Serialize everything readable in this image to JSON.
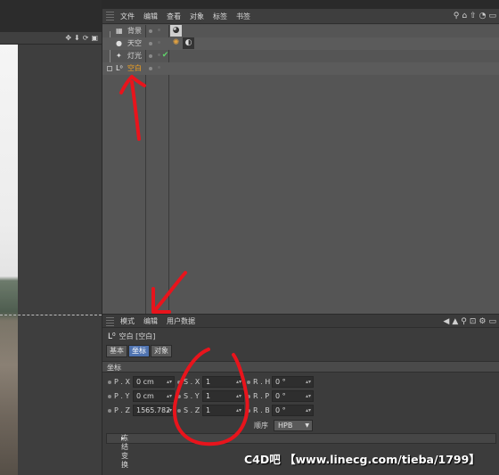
{
  "object_manager": {
    "menu": [
      "文件",
      "编辑",
      "查看",
      "对象",
      "标签",
      "书签"
    ],
    "toolbar_icons": [
      "search-icon",
      "home-icon",
      "up-icon",
      "pin-icon",
      "expand-icon"
    ],
    "objects": [
      {
        "name": "背景",
        "icon": "background-icon",
        "selected": false,
        "tag": "material-tag"
      },
      {
        "name": "天空",
        "icon": "sky-icon",
        "selected": false,
        "tag": "material-tag"
      },
      {
        "name": "灯光",
        "icon": "light-icon",
        "selected": false,
        "tag": "check-tag"
      },
      {
        "name": "空白",
        "icon": "null-icon",
        "selected": true,
        "tag": ""
      }
    ]
  },
  "viewport": {
    "toolbar_icons": [
      "move-icon",
      "down-arrow-icon",
      "rotate-icon",
      "maximize-icon"
    ]
  },
  "attribute_manager": {
    "menu": [
      "模式",
      "编辑",
      "用户数据"
    ],
    "toolbar_icons": [
      "back-arrow-icon",
      "up-arrow-icon",
      "search-icon",
      "lock-icon",
      "settings-icon",
      "expand-icon"
    ],
    "title": "空白 [空白]",
    "tabs": [
      {
        "label": "基本",
        "active": false
      },
      {
        "label": "坐标",
        "active": true
      },
      {
        "label": "对象",
        "active": false
      }
    ],
    "section": "坐标",
    "position": {
      "x": {
        "label": "P . X",
        "value": "0 cm"
      },
      "y": {
        "label": "P . Y",
        "value": "0 cm"
      },
      "z": {
        "label": "P . Z",
        "value": "1565.782"
      }
    },
    "scale": {
      "x": {
        "label": "S . X",
        "value": "1"
      },
      "y": {
        "label": "S . Y",
        "value": "1"
      },
      "z": {
        "label": "S . Z",
        "value": "1"
      }
    },
    "rotation": {
      "h": {
        "label": "R . H",
        "value": "0 °"
      },
      "p": {
        "label": "R . P",
        "value": "0 °"
      },
      "b": {
        "label": "R . B",
        "value": "0 °"
      }
    },
    "order_label": "顺序",
    "order_value": "HPB",
    "freeze_section": "冻结变换"
  },
  "watermark": "C4D吧 【www.linecg.com/tieba/1799】",
  "colors": {
    "annotation": "#e8141c",
    "selected_object": "#f0a020",
    "active_tab": "#4f73b0"
  }
}
